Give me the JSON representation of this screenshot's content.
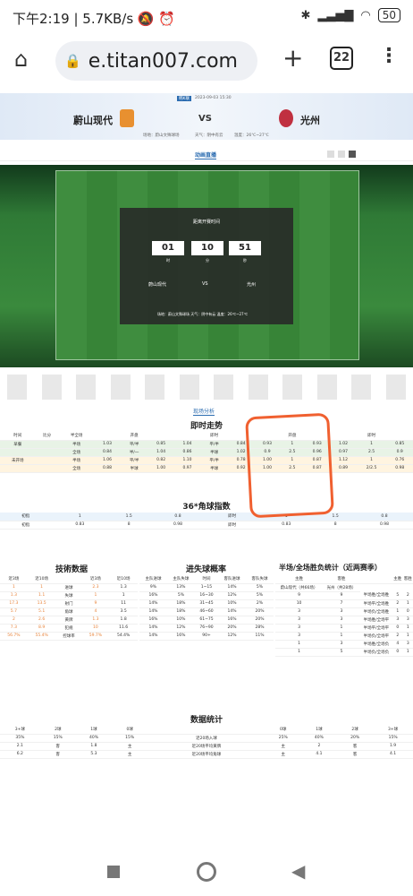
{
  "status": {
    "time": "下午2:19",
    "speed": "5.7KB/s",
    "battery": "50"
  },
  "browser": {
    "url": "e.titan007.com",
    "tab_count": "22"
  },
  "match": {
    "tag": "韩K联",
    "datetime": "2023-09-03 15:30",
    "home": "蔚山现代",
    "away": "光州",
    "vs": "VS",
    "venue": "场地：蔚山文殊球场",
    "weather": "天气：阴中有云",
    "temp": "温度：26℃~27℃"
  },
  "tabs": {
    "live": "动画直播"
  },
  "timer": {
    "title": "距离开赛时间",
    "h": "01",
    "m": "10",
    "s": "51",
    "hl": "时",
    "ml": "分",
    "sl": "秒",
    "home": "蔚山现代",
    "vs": "VS",
    "away": "光州",
    "footer": "场地：蔚山文殊球场 天气：阴中有云 温度：26℃~27℃"
  },
  "analysis": {
    "tab": "现场分析",
    "trend_title": "即时走势",
    "corner_title": "36*角球指数",
    "tech_title": "技術数据",
    "goal_title": "进失球概率",
    "half_title": "半场/全场胜负统计（近两赛季）",
    "stats_title": "数据统计"
  },
  "trend": {
    "head": [
      "时间",
      "比分",
      "半全场",
      "",
      "开盘",
      "",
      "",
      "即时",
      "",
      "",
      "开盘",
      "",
      "",
      "即时",
      ""
    ],
    "rows": [
      [
        "早餐",
        "",
        "半场",
        "1.03",
        "平/半",
        "0.85",
        "1.04",
        "平/半",
        "0.84",
        "0.93",
        "1",
        "0.93",
        "1.02",
        "1",
        "0.85"
      ],
      [
        "",
        "",
        "全场",
        "0.84",
        "半/一",
        "1.04",
        "0.86",
        "半球",
        "1.02",
        "0.9",
        "2.5",
        "0.96",
        "0.97",
        "2.5",
        "0.9"
      ],
      [
        "未开场",
        "",
        "半场",
        "1.06",
        "平/半",
        "0.82",
        "1.10",
        "平/半",
        "0.78",
        "1.00",
        "1",
        "0.87",
        "1.12",
        "1",
        "0.76"
      ],
      [
        "",
        "",
        "全场",
        "0.88",
        "半球",
        "1.00",
        "0.97",
        "半球",
        "0.92",
        "1.00",
        "2.5",
        "0.87",
        "0.89",
        "2/2.5",
        "0.98"
      ]
    ]
  },
  "corner": {
    "r1": [
      "初指",
      "1",
      "1.5",
      "0.8",
      "即时",
      "1",
      "1.5",
      "0.8"
    ],
    "r2": [
      "初指",
      "0.83",
      "8",
      "0.98",
      "即时",
      "0.83",
      "8",
      "0.98"
    ]
  },
  "tech": {
    "head": [
      "近3场",
      "近10场",
      "",
      "近3场",
      "近10场"
    ],
    "rows": [
      [
        "1",
        "1",
        "进球",
        "2.3",
        "1.3"
      ],
      [
        "1.3",
        "1.1",
        "失球",
        "1",
        "1"
      ],
      [
        "17.3",
        "13.5",
        "射门",
        "9",
        "11"
      ],
      [
        "5.7",
        "5.1",
        "角球",
        "4",
        "3.5"
      ],
      [
        "2",
        "2.6",
        "黄牌",
        "1.3",
        "1.8"
      ],
      [
        "7.3",
        "8.9",
        "犯规",
        "10",
        "11.6"
      ],
      [
        "56.7%",
        "55.4%",
        "控球率",
        "59.7%",
        "54.4%"
      ]
    ]
  },
  "goal": {
    "head": [
      "主队进球",
      "主队失球",
      "时间",
      "客队进球",
      "客队失球"
    ],
    "rows": [
      [
        "9%",
        "13%",
        "1~15",
        "14%",
        "5%"
      ],
      [
        "16%",
        "5%",
        "16~30",
        "12%",
        "5%"
      ],
      [
        "14%",
        "18%",
        "31~45",
        "10%",
        "2%"
      ],
      [
        "14%",
        "18%",
        "46~60",
        "14%",
        "20%"
      ],
      [
        "16%",
        "10%",
        "61~75",
        "16%",
        "20%"
      ],
      [
        "14%",
        "12%",
        "76~90",
        "20%",
        "28%"
      ],
      [
        "14%",
        "16%",
        "90+",
        "12%",
        "11%"
      ]
    ]
  },
  "half": {
    "head": [
      "主胜",
      "客胜",
      "",
      "主胜",
      "客胜"
    ],
    "sub": [
      "蔚山现代（共66场）",
      "光州（共28场）"
    ],
    "rows": [
      [
        "9",
        "9",
        "半场胜/全场胜",
        "5",
        "2"
      ],
      [
        "10",
        "7",
        "半场平/全场胜",
        "2",
        "1"
      ],
      [
        "3",
        "3",
        "半场负/全场胜",
        "1",
        "0"
      ],
      [
        "3",
        "3",
        "半场胜/全场平",
        "3",
        "3"
      ],
      [
        "3",
        "1",
        "半场平/全场平",
        "0",
        "1"
      ],
      [
        "3",
        "1",
        "半场负/全场平",
        "2",
        "1"
      ],
      [
        "1",
        "3",
        "半场胜/全场负",
        "4",
        "3"
      ],
      [
        "1",
        "5",
        "半场负/全场负",
        "0",
        "1"
      ]
    ]
  },
  "stats": {
    "head": [
      "3+球",
      "2球",
      "1球",
      "0球",
      "",
      "0球",
      "1球",
      "2球",
      "3+球"
    ],
    "rows": [
      [
        "35%",
        "15%",
        "40%",
        "15%",
        "近20场入球",
        "25%",
        "40%",
        "20%",
        "15%"
      ],
      [
        "2.1",
        "客",
        "1.8",
        "主",
        "近20场平均黄牌",
        "主",
        "2",
        "客",
        "1.9"
      ],
      [
        "6.2",
        "客",
        "5.3",
        "主",
        "近20场平均角球",
        "主",
        "4.1",
        "客",
        "4.1"
      ]
    ]
  }
}
